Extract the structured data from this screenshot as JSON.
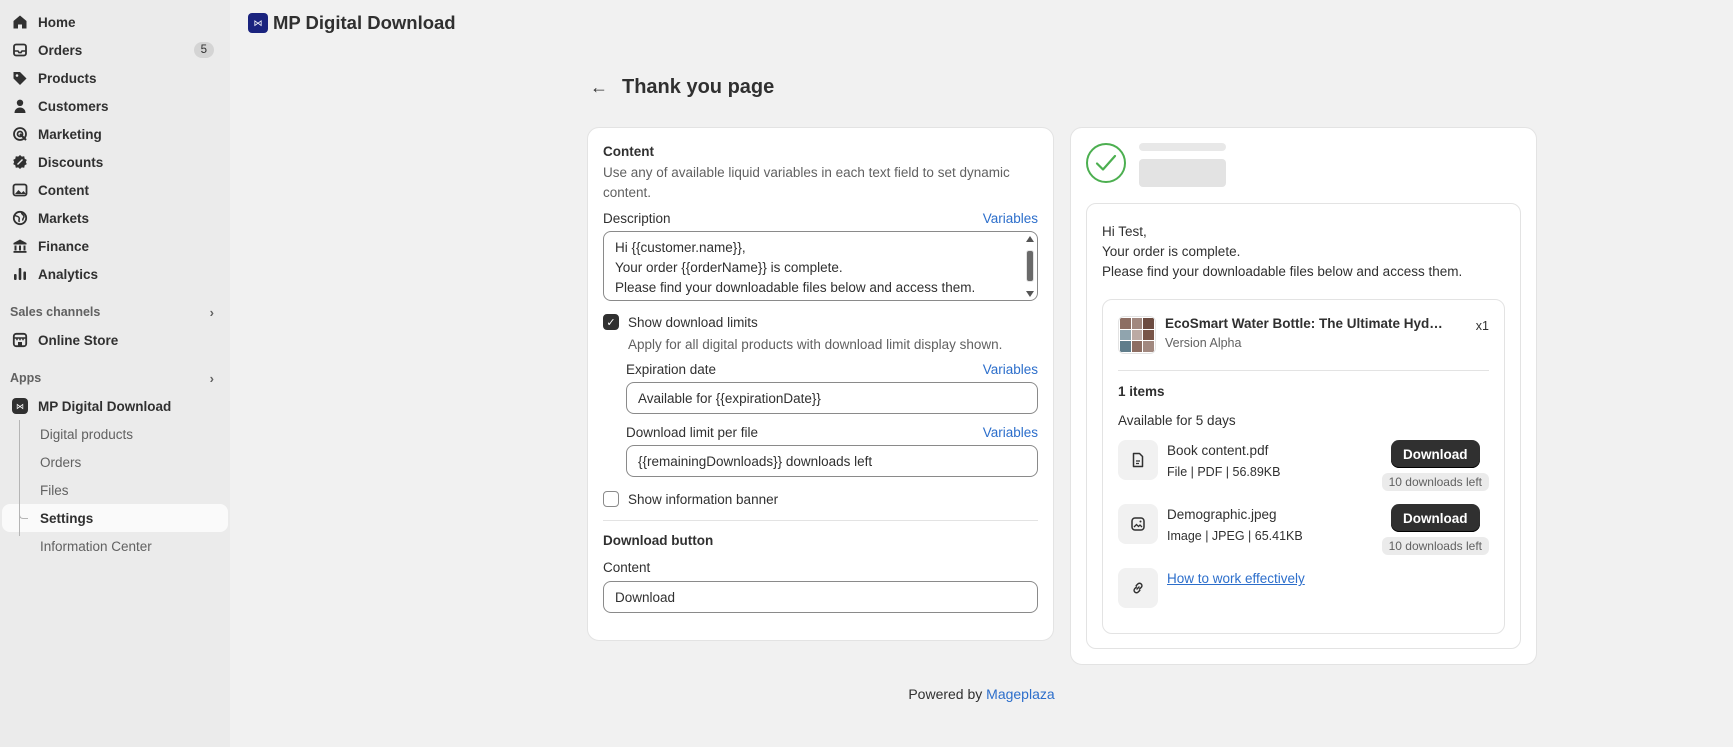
{
  "sidebar": {
    "items": [
      {
        "label": "Home",
        "icon": "home-icon"
      },
      {
        "label": "Orders",
        "icon": "inbox-icon",
        "badge": "5"
      },
      {
        "label": "Products",
        "icon": "tag-icon"
      },
      {
        "label": "Customers",
        "icon": "person-icon"
      },
      {
        "label": "Marketing",
        "icon": "target-icon"
      },
      {
        "label": "Discounts",
        "icon": "discount-icon"
      },
      {
        "label": "Content",
        "icon": "image-icon"
      },
      {
        "label": "Markets",
        "icon": "globe-icon"
      },
      {
        "label": "Finance",
        "icon": "bank-icon"
      },
      {
        "label": "Analytics",
        "icon": "chart-bar-icon"
      }
    ],
    "sales_channels_label": "Sales channels",
    "online_store_label": "Online Store",
    "apps_label": "Apps",
    "app_name": "MP Digital Download",
    "app_sub_items": [
      "Digital products",
      "Orders",
      "Files",
      "Settings",
      "Information Center"
    ]
  },
  "header": {
    "app_title": "MP Digital Download"
  },
  "page": {
    "title": "Thank you page"
  },
  "content_card": {
    "heading": "Content",
    "helper": "Use any of available liquid variables in each text field to set dynamic content.",
    "description_label": "Description",
    "variables_label": "Variables",
    "description_lines": [
      "Hi {{customer.name}},",
      "Your order {{orderName}} is complete.",
      "Please find your downloadable files below and access them."
    ],
    "show_download_limits_label": "Show download limits",
    "show_download_limits_checked": true,
    "download_limits_helper": "Apply for all digital products with download limit display shown.",
    "expiration_label": "Expiration date",
    "expiration_value": "Available for {{expirationDate}}",
    "limit_label": "Download limit per file",
    "limit_value": "{{remainingDownloads}} downloads left",
    "show_info_banner_label": "Show information banner",
    "show_info_banner_checked": false,
    "download_button_heading": "Download button",
    "button_content_label": "Content",
    "button_content_value": "Download"
  },
  "preview": {
    "greeting_lines": [
      "Hi Test,",
      "Your order is complete.",
      "Please find your downloadable files below and access them."
    ],
    "product_name": "EcoSmart Water Bottle: The Ultimate Hydr...",
    "product_variant": "Version Alpha",
    "quantity": "x1",
    "items_count": "1 items",
    "availability": "Available for 5 days",
    "files": [
      {
        "name": "Book content.pdf",
        "meta": "File | PDF | 56.89KB",
        "button": "Download",
        "remaining": "10 downloads left",
        "icon": "file-icon"
      },
      {
        "name": "Demographic.jpeg",
        "meta": "Image | JPEG | 65.41KB",
        "button": "Download",
        "remaining": "10 downloads left",
        "icon": "image-file-icon"
      }
    ],
    "link": {
      "label": "How to work effectively",
      "icon": "link-icon"
    }
  },
  "footer": {
    "powered_by": "Powered by",
    "brand": "Mageplaza"
  },
  "colors": {
    "accent": "#2c6ecb",
    "success": "#4caf50",
    "primary_button": "#303030"
  }
}
